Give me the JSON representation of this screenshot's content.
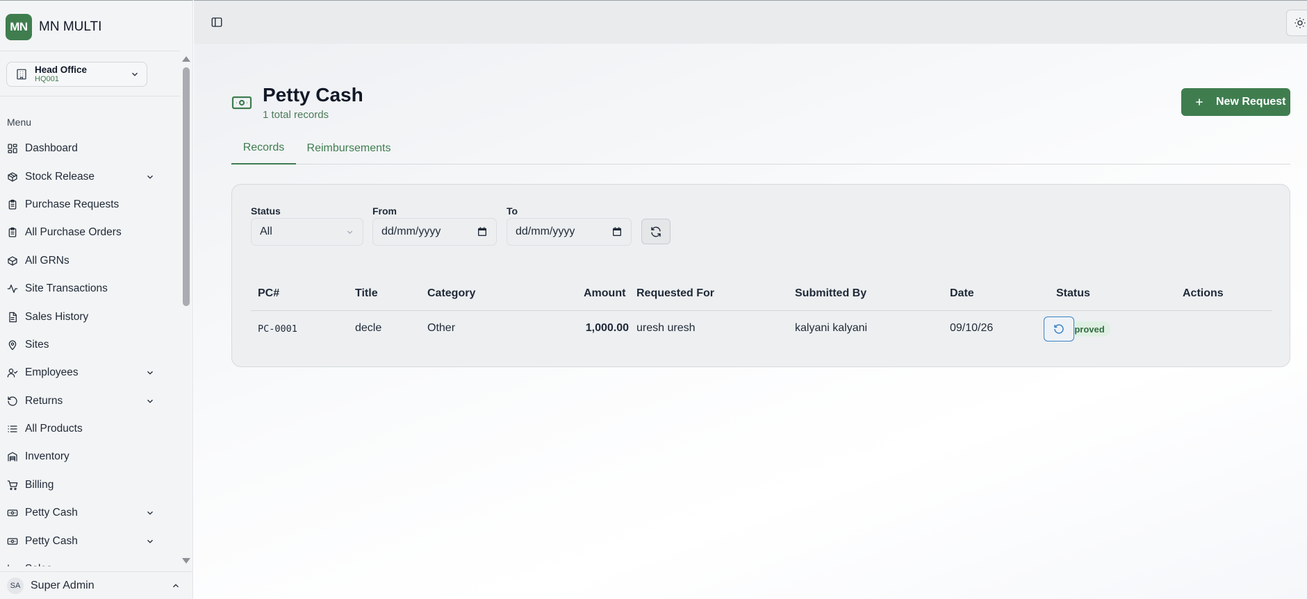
{
  "app": {
    "initials": "MN",
    "name": "MN MULTI"
  },
  "branch": {
    "name": "Head Office",
    "code": "HQ001"
  },
  "sidebar": {
    "menu_label": "Menu",
    "items": [
      {
        "label": "Dashboard",
        "icon": "dashboard-icon",
        "expandable": false
      },
      {
        "label": "Stock Release",
        "icon": "box-icon",
        "expandable": true
      },
      {
        "label": "Purchase Requests",
        "icon": "clipboard-icon",
        "expandable": false
      },
      {
        "label": "All Purchase Orders",
        "icon": "clipboard-icon",
        "expandable": false
      },
      {
        "label": "All GRNs",
        "icon": "package-icon",
        "expandable": false
      },
      {
        "label": "Site Transactions",
        "icon": "activity-icon",
        "expandable": false
      },
      {
        "label": "Sales History",
        "icon": "document-icon",
        "expandable": false
      },
      {
        "label": "Sites",
        "icon": "map-pin-icon",
        "expandable": false
      },
      {
        "label": "Employees",
        "icon": "user-check-icon",
        "expandable": true
      },
      {
        "label": "Returns",
        "icon": "rotate-icon",
        "expandable": true
      },
      {
        "label": "All Products",
        "icon": "list-icon",
        "expandable": false
      },
      {
        "label": "Inventory",
        "icon": "warehouse-icon",
        "expandable": false
      },
      {
        "label": "Billing",
        "icon": "cart-icon",
        "expandable": false
      },
      {
        "label": "Petty Cash",
        "icon": "cash-icon",
        "expandable": true
      },
      {
        "label": "Petty Cash",
        "icon": "cash-icon",
        "expandable": true
      },
      {
        "label": "Sales",
        "icon": "chart-icon",
        "expandable": false
      }
    ]
  },
  "user": {
    "initials": "SA",
    "name": "Super Admin"
  },
  "page": {
    "title": "Petty Cash",
    "subtitle": "1 total records",
    "new_button": "New Request",
    "tabs": [
      {
        "label": "Records",
        "active": true
      },
      {
        "label": "Reimbursements",
        "active": false
      }
    ]
  },
  "filters": {
    "status": {
      "label": "Status",
      "value": "All"
    },
    "from": {
      "label": "From",
      "placeholder": "dd/mm/yyyy"
    },
    "to": {
      "label": "To",
      "placeholder": "dd/mm/yyyy"
    }
  },
  "table": {
    "columns": [
      "PC#",
      "Title",
      "Category",
      "Amount",
      "Requested For",
      "Submitted By",
      "Date",
      "Status",
      "Actions"
    ],
    "rows": [
      {
        "pc": "PC-0001",
        "title": "decle",
        "category": "Other",
        "amount": "1,000.00",
        "requested_for": "uresh uresh",
        "submitted_by": "kalyani kalyani",
        "date": "09/10/26",
        "status": "Approved"
      }
    ]
  },
  "colors": {
    "accent": "#3f7d4f",
    "status_approved_bg": "#dff0e3",
    "action_border": "#3b82c4"
  }
}
